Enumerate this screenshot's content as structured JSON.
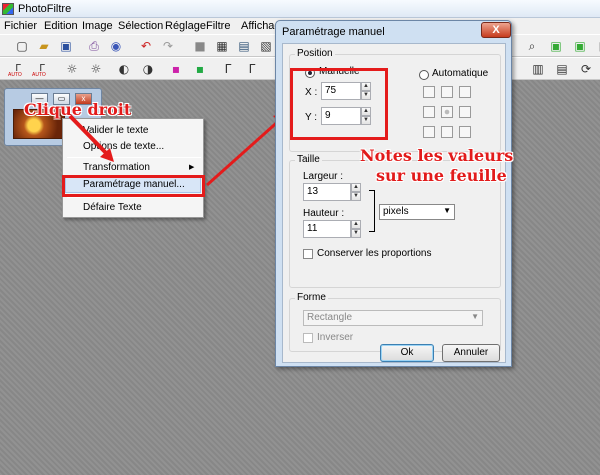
{
  "app": {
    "title": "PhotoFiltre"
  },
  "menu": [
    "Fichier",
    "Edition",
    "Image",
    "Sélection",
    "Réglage",
    "Filtre",
    "Affichag"
  ],
  "toolbar2": {
    "auto_label_1": "AUTO",
    "auto_label_2": "AUTO"
  },
  "context_menu": {
    "items": [
      "Valider le texte",
      "Options de texte...",
      "Transformation",
      "Paramétrage manuel...",
      "Défaire Texte"
    ],
    "highlighted_index": 3
  },
  "annotations": {
    "right_click": "Clique droit",
    "note_line1": "Notes les valeurs",
    "note_line2": "sur une feuille"
  },
  "dialog": {
    "title": "Paramétrage manuel",
    "close_symbol": "X",
    "position": {
      "label": "Position",
      "manual_label": "Manuelle",
      "automatic_label": "Automatique",
      "mode": "Manuelle",
      "x_label": "X :",
      "x_value": "75",
      "y_label": "Y :",
      "y_value": "9"
    },
    "size": {
      "label": "Taille",
      "width_label": "Largeur :",
      "width_value": "13",
      "height_label": "Hauteur :",
      "height_value": "11",
      "unit": "pixels",
      "keep_ratio_label": "Conserver les proportions",
      "keep_ratio_checked": false
    },
    "shape": {
      "label": "Forme",
      "shape_value": "Rectangle",
      "invert_label": "Inverser",
      "invert_checked": false
    },
    "ok_label": "Ok",
    "cancel_label": "Annuler"
  },
  "colors": {
    "annotation_red": "#e41b1b",
    "dialog_frame": "#cfe0f2",
    "workspace": "#8c8c8c"
  }
}
